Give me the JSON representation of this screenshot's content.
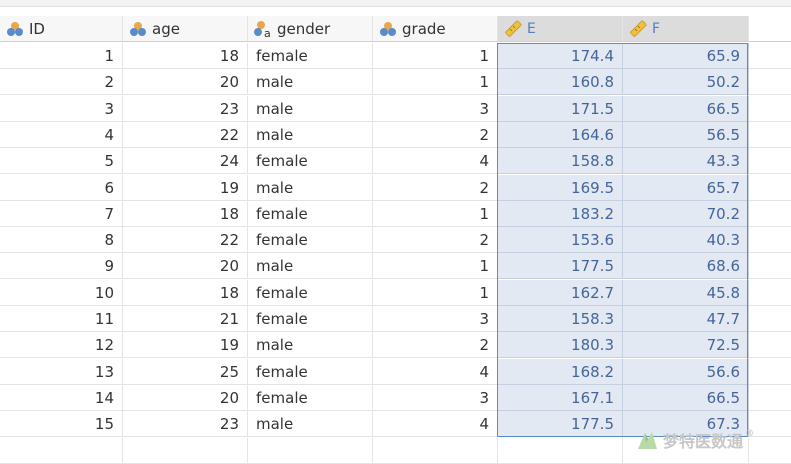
{
  "columns": [
    {
      "key": "id",
      "label": "ID",
      "type": "nominal-numeric"
    },
    {
      "key": "age",
      "label": "age",
      "type": "nominal-numeric"
    },
    {
      "key": "gender",
      "label": "gender",
      "type": "nominal-text"
    },
    {
      "key": "grade",
      "label": "grade",
      "type": "nominal-numeric"
    },
    {
      "key": "e",
      "label": "E",
      "type": "continuous"
    },
    {
      "key": "f",
      "label": "F",
      "type": "continuous"
    }
  ],
  "rows": [
    {
      "id": "1",
      "age": "18",
      "gender": "female",
      "grade": "1",
      "e": "174.4",
      "f": "65.9"
    },
    {
      "id": "2",
      "age": "20",
      "gender": "male",
      "grade": "1",
      "e": "160.8",
      "f": "50.2"
    },
    {
      "id": "3",
      "age": "23",
      "gender": "male",
      "grade": "3",
      "e": "171.5",
      "f": "66.5"
    },
    {
      "id": "4",
      "age": "22",
      "gender": "male",
      "grade": "2",
      "e": "164.6",
      "f": "56.5"
    },
    {
      "id": "5",
      "age": "24",
      "gender": "female",
      "grade": "4",
      "e": "158.8",
      "f": "43.3"
    },
    {
      "id": "6",
      "age": "19",
      "gender": "male",
      "grade": "2",
      "e": "169.5",
      "f": "65.7"
    },
    {
      "id": "7",
      "age": "18",
      "gender": "female",
      "grade": "1",
      "e": "183.2",
      "f": "70.2"
    },
    {
      "id": "8",
      "age": "22",
      "gender": "female",
      "grade": "2",
      "e": "153.6",
      "f": "40.3"
    },
    {
      "id": "9",
      "age": "20",
      "gender": "male",
      "grade": "1",
      "e": "177.5",
      "f": "68.6"
    },
    {
      "id": "10",
      "age": "18",
      "gender": "female",
      "grade": "1",
      "e": "162.7",
      "f": "45.8"
    },
    {
      "id": "11",
      "age": "21",
      "gender": "female",
      "grade": "3",
      "e": "158.3",
      "f": "47.7"
    },
    {
      "id": "12",
      "age": "19",
      "gender": "male",
      "grade": "2",
      "e": "180.3",
      "f": "72.5"
    },
    {
      "id": "13",
      "age": "25",
      "gender": "female",
      "grade": "4",
      "e": "168.2",
      "f": "56.6"
    },
    {
      "id": "14",
      "age": "20",
      "gender": "female",
      "grade": "3",
      "e": "167.1",
      "f": "66.5"
    },
    {
      "id": "15",
      "age": "23",
      "gender": "male",
      "grade": "4",
      "e": "177.5",
      "f": "67.3"
    }
  ],
  "watermark": {
    "text": "梦特医数通",
    "mark": "®"
  },
  "colors": {
    "selection_fill": "#e3e9f3",
    "selection_border": "#5b8bc9",
    "selected_text": "#43659a",
    "nominal_icon": "#e6a84a",
    "continuous_icon": "#f0c043"
  }
}
